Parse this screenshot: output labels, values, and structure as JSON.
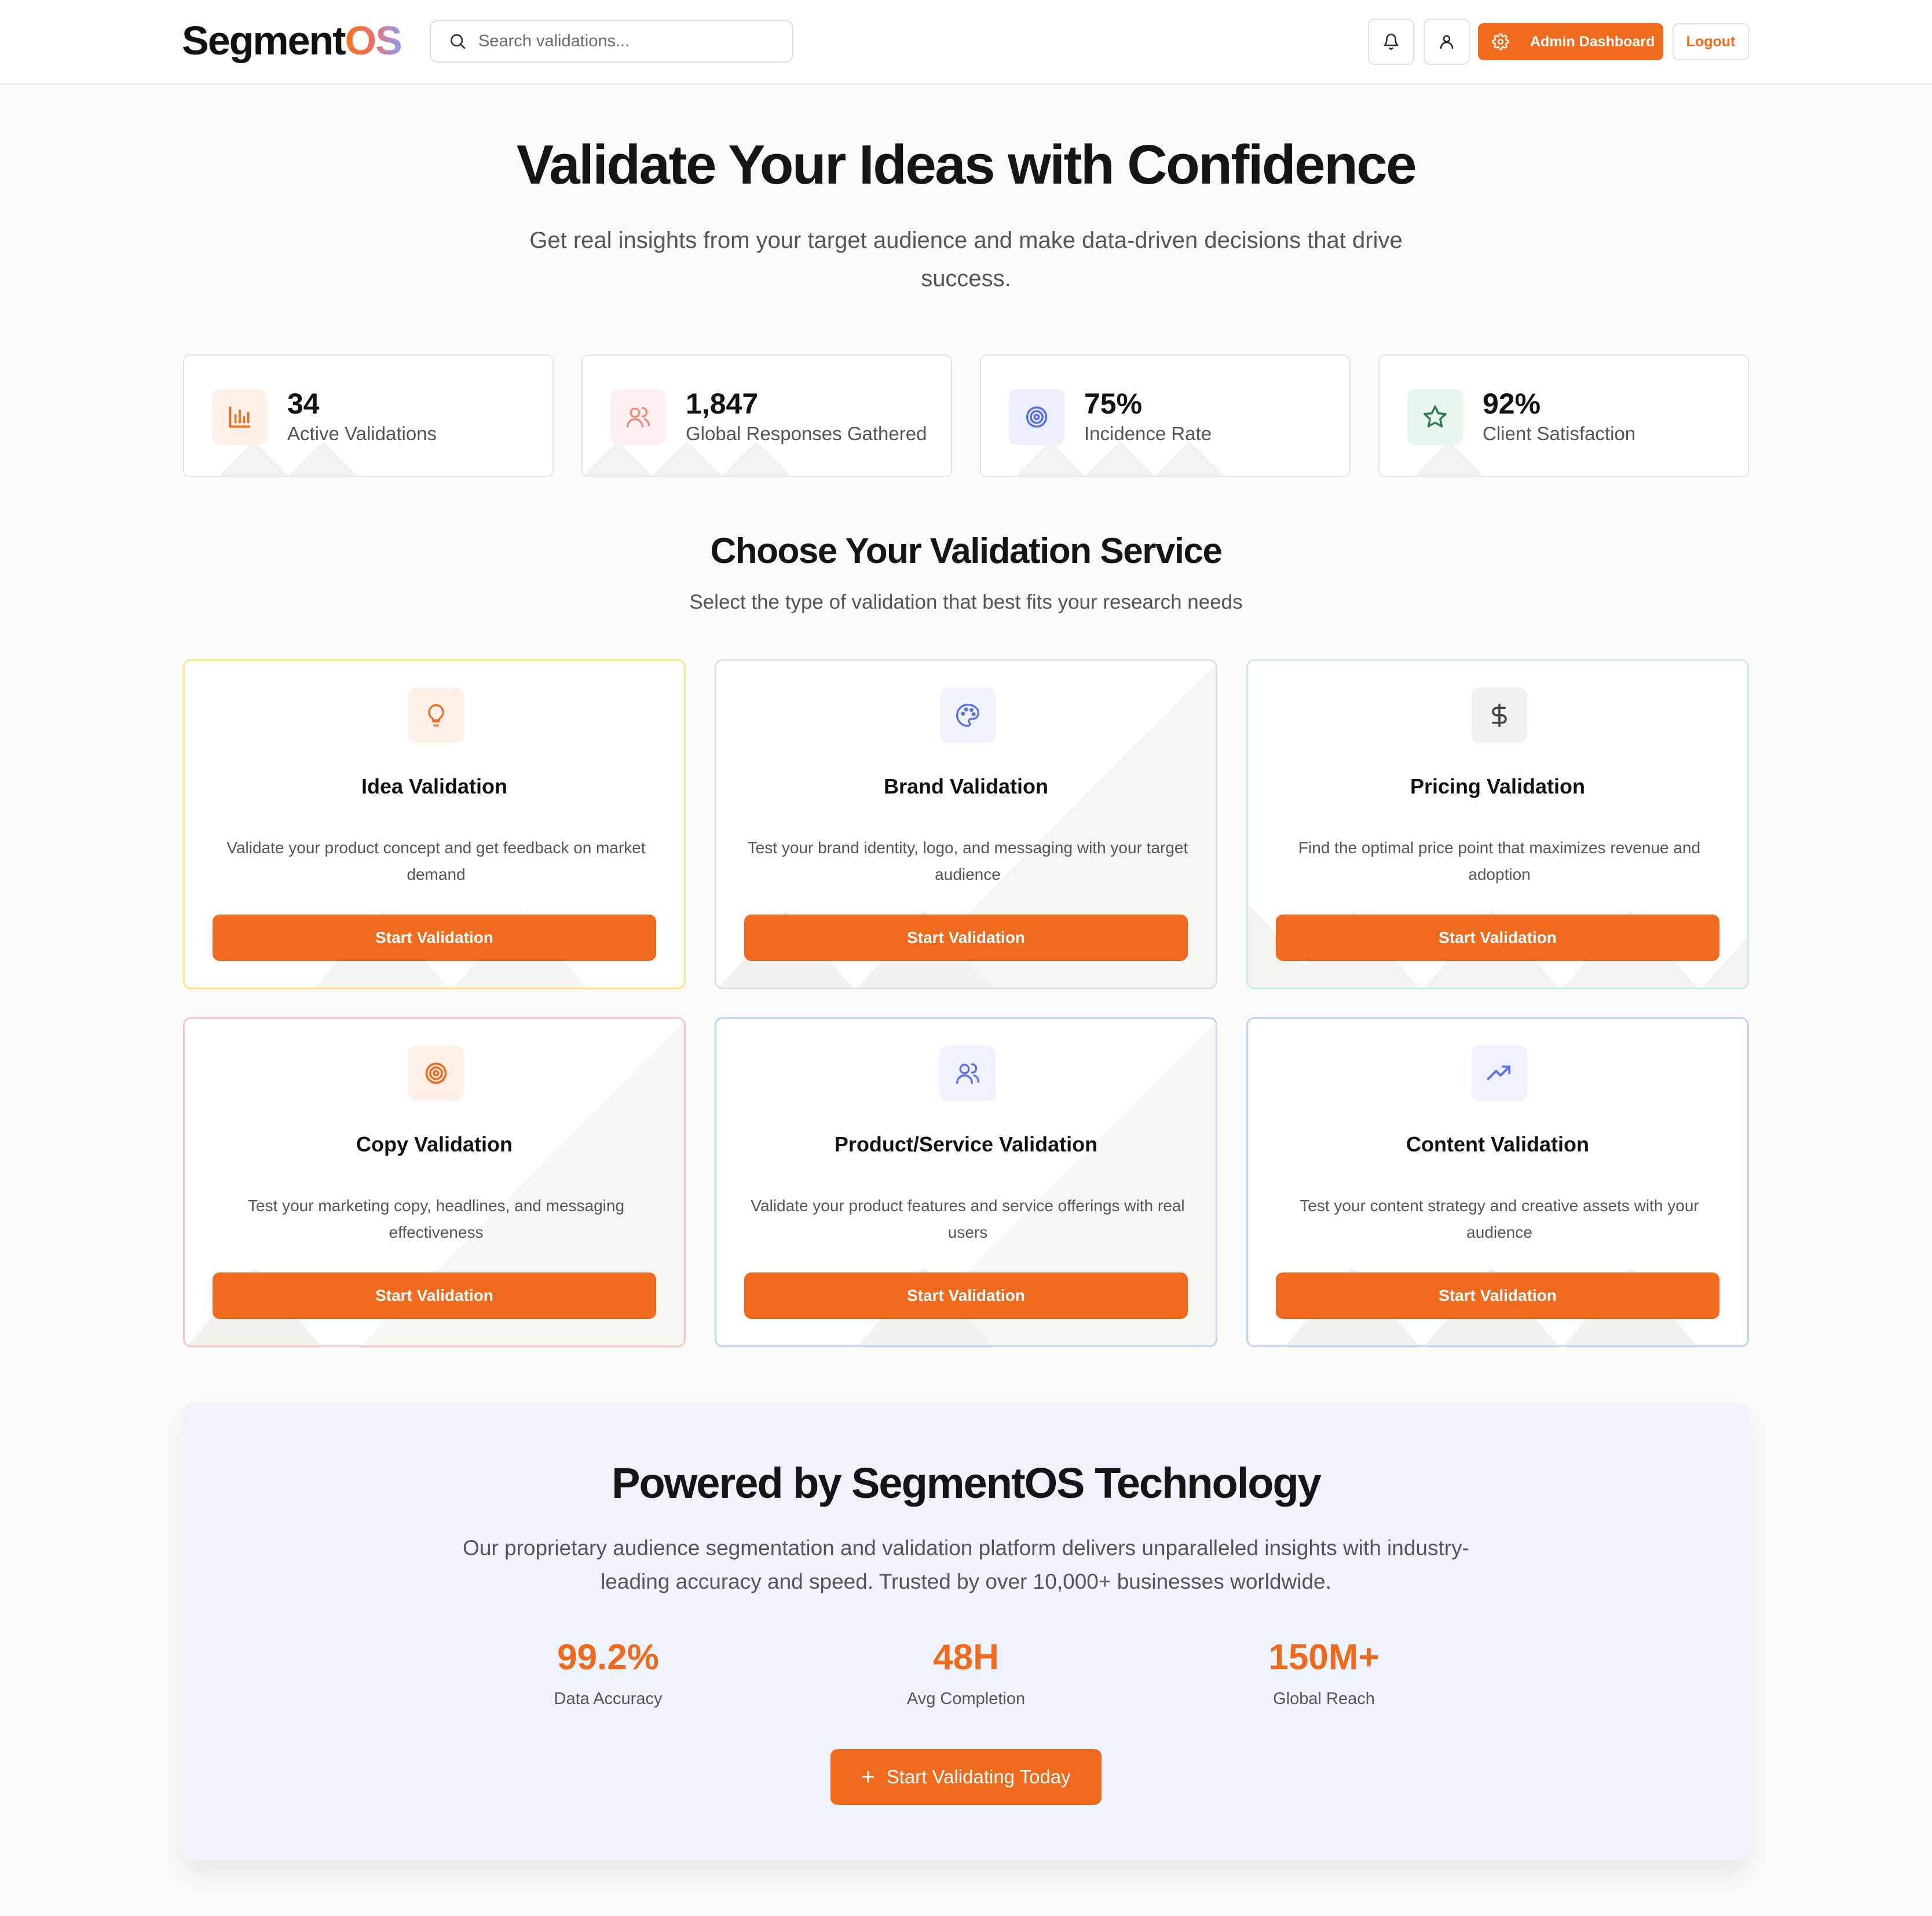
{
  "header": {
    "logo_main": "Segment",
    "logo_accent": "OS",
    "search_placeholder": "Search validations...",
    "notifications_icon": "bell-icon",
    "profile_icon": "user-icon",
    "admin_label": "Admin Dashboard",
    "logout_label": "Logout"
  },
  "hero": {
    "title": "Validate Your Ideas with Confidence",
    "subtitle": "Get real insights from your target audience and make data-driven decisions that drive success."
  },
  "stats": [
    {
      "value": "34",
      "label": "Active Validations",
      "icon": "bar-chart-icon",
      "color": "#f06a1d",
      "bg": "#fff1e8"
    },
    {
      "value": "1,847",
      "label": "Global Responses Gathered",
      "icon": "users-icon",
      "color": "#ee8a80",
      "bg": "#fdf0ef"
    },
    {
      "value": "75%",
      "label": "Incidence Rate",
      "icon": "target-icon",
      "color": "#5b6fe6",
      "bg": "#ecefff"
    },
    {
      "value": "92%",
      "label": "Client Satisfaction",
      "icon": "star-icon",
      "color": "#2f9e5c",
      "bg": "#e6f7ec"
    }
  ],
  "services_section": {
    "title": "Choose Your Validation Service",
    "subtitle": "Select the type of validation that best fits your research needs"
  },
  "services": [
    {
      "title": "Idea Validation",
      "desc": "Validate your product concept and get feedback on market demand",
      "button": "Start Validation",
      "icon": "lightbulb-icon",
      "border": "#fde68a",
      "icon_color": "#f06a1d",
      "icon_bg": "#fff1e8"
    },
    {
      "title": "Brand Validation",
      "desc": "Test your brand identity, logo, and messaging with your target audience",
      "button": "Start Validation",
      "icon": "palette-icon",
      "border": "#e2e2e2",
      "icon_color": "#5b6fe6",
      "icon_bg": "#f1f3ff"
    },
    {
      "title": "Pricing Validation",
      "desc": "Find the optimal price point that maximizes revenue and adoption",
      "button": "Start Validation",
      "icon": "dollar-icon",
      "border": "#c9efd6",
      "icon_color": "#444444",
      "icon_bg": "#f0f0f0"
    },
    {
      "title": "Copy Validation",
      "desc": "Test your marketing copy, headlines, and messaging effectiveness",
      "button": "Start Validation",
      "icon": "target-icon",
      "border": "#f6c6c6",
      "icon_color": "#f06a1d",
      "icon_bg": "#fff1e8"
    },
    {
      "title": "Product/Service Validation",
      "desc": "Validate your product features and service offerings with real users",
      "button": "Start Validation",
      "icon": "users-icon",
      "border": "#bfd3f6",
      "icon_color": "#5b6fe6",
      "icon_bg": "#eef2ff"
    },
    {
      "title": "Content Validation",
      "desc": "Test your content strategy and creative assets with your audience",
      "button": "Start Validation",
      "icon": "trending-up-icon",
      "border": "#bfd3f6",
      "icon_color": "#5b6fe6",
      "icon_bg": "#eef2ff"
    }
  ],
  "powered": {
    "title": "Powered by SegmentOS Technology",
    "subtitle": "Our proprietary audience segmentation and validation platform delivers unparalleled insights with industry-leading accuracy and speed. Trusted by over 10,000+ businesses worldwide.",
    "metrics": [
      {
        "value": "99.2%",
        "label": "Data Accuracy"
      },
      {
        "value": "48H",
        "label": "Avg Completion"
      },
      {
        "value": "150M+",
        "label": "Global Reach"
      }
    ],
    "cta_label": "Start Validating Today",
    "cta_icon": "plus-icon"
  },
  "colors": {
    "accent": "#f06a1d",
    "page_bg": "#fafafa",
    "powered_bg": "#eef3fd"
  }
}
